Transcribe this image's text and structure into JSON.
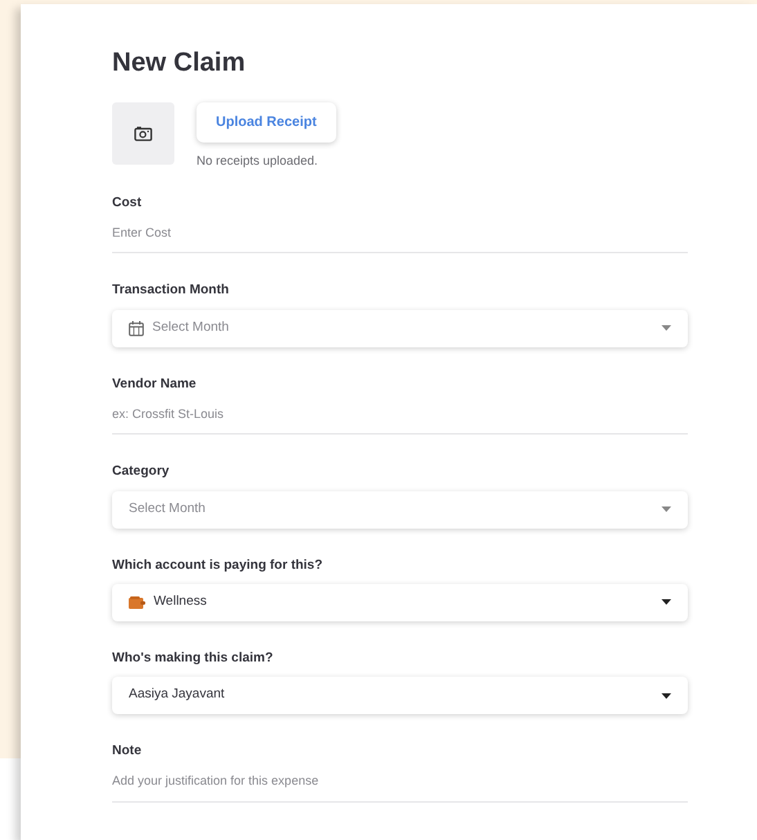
{
  "title": "New Claim",
  "receipt": {
    "button": "Upload Receipt",
    "status": "No receipts uploaded."
  },
  "fields": [
    {
      "kind": "text",
      "label": "Cost",
      "placeholder": "Enter Cost"
    },
    {
      "kind": "date-select",
      "label": "Transaction Month",
      "placeholder": "Select Month"
    },
    {
      "kind": "text",
      "label": "Vendor Name",
      "placeholder": "ex: Crossfit St-Louis"
    },
    {
      "kind": "select",
      "label": "Category",
      "placeholder": "Select Month"
    },
    {
      "kind": "account-select",
      "label": "Which account is paying for this?",
      "value": "Wellness"
    },
    {
      "kind": "select",
      "label": "Who's making this claim?",
      "value": "Aasiya Jayavant"
    },
    {
      "kind": "text",
      "label": "Note",
      "placeholder": "Add your justification for this expense"
    }
  ]
}
